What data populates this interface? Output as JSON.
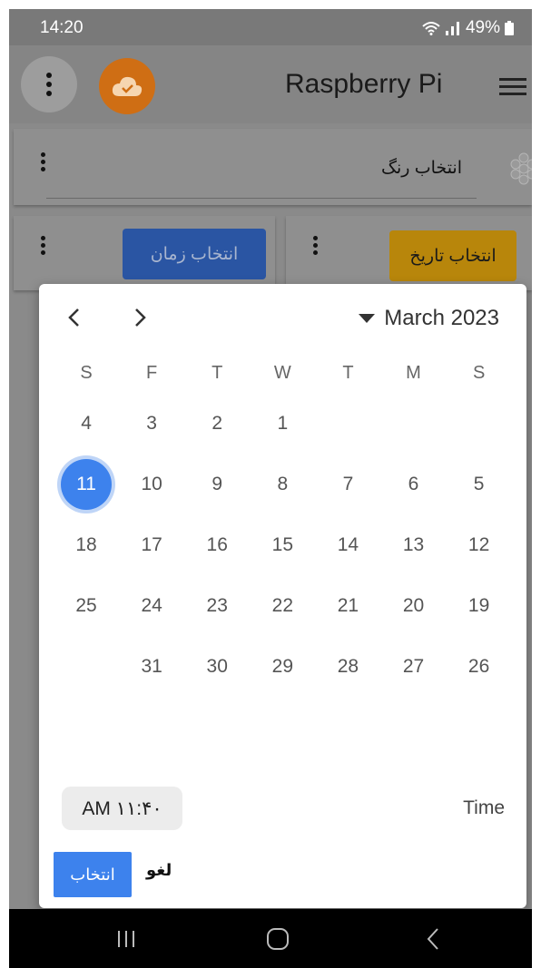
{
  "status_bar": {
    "time": "14:20",
    "battery": "49%"
  },
  "app_bar": {
    "title": "Raspberry Pi"
  },
  "color_card": {
    "label": "انتخاب رنگ"
  },
  "time_card": {
    "button_label": "انتخاب زمان"
  },
  "date_card": {
    "button_label": "انتخاب تاریخ"
  },
  "date_picker": {
    "month_label": "March 2023",
    "weekdays": [
      "S",
      "F",
      "T",
      "W",
      "T",
      "M",
      "S"
    ],
    "weeks": [
      [
        "4",
        "3",
        "2",
        "1",
        "",
        "",
        ""
      ],
      [
        "11",
        "10",
        "9",
        "8",
        "7",
        "6",
        "5"
      ],
      [
        "18",
        "17",
        "16",
        "15",
        "14",
        "13",
        "12"
      ],
      [
        "25",
        "24",
        "23",
        "22",
        "21",
        "20",
        "19"
      ],
      [
        "",
        "31",
        "30",
        "29",
        "28",
        "27",
        "26"
      ]
    ],
    "selected_day": "11",
    "time_value": "AM ۱۱:۴۰",
    "time_label": "Time",
    "cancel_label": "لغو",
    "ok_label": "انتخاب"
  },
  "colors": {
    "accent": "#3d82ed",
    "cloud": "#cf6e14",
    "date_button": "#b8860b",
    "time_button": "#2a55a3"
  }
}
